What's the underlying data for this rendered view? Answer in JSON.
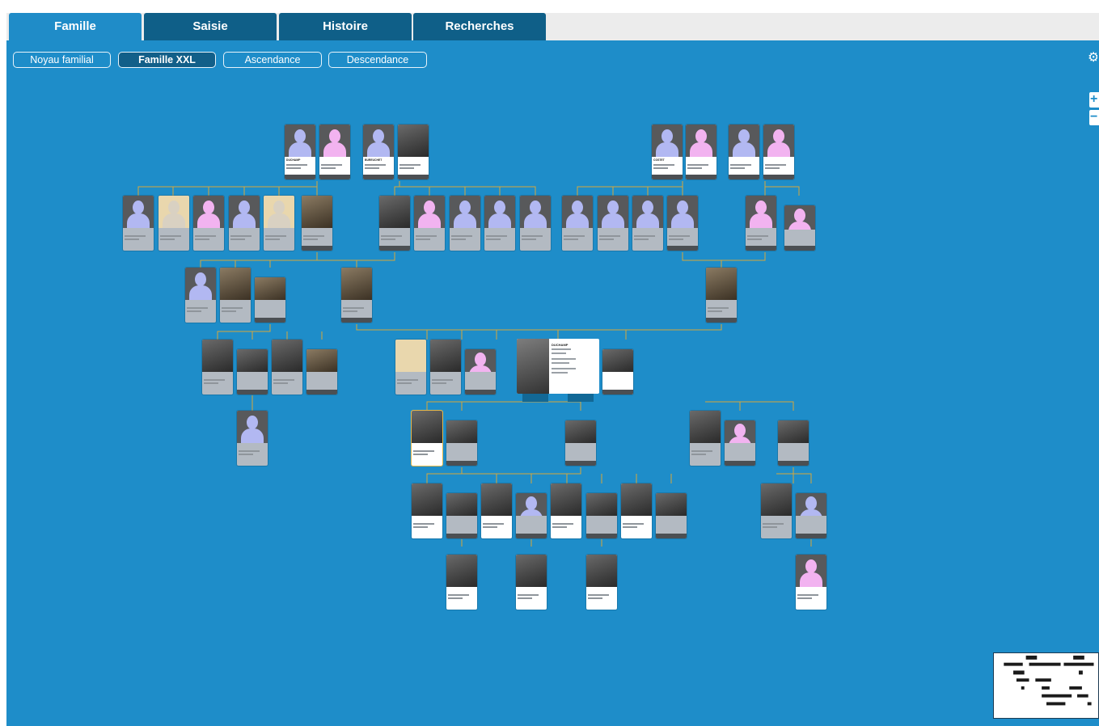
{
  "tabs": [
    {
      "label": "Famille",
      "active": true
    },
    {
      "label": "Saisie",
      "active": false
    },
    {
      "label": "Histoire",
      "active": false
    },
    {
      "label": "Recherches",
      "active": false
    }
  ],
  "subnav": [
    {
      "label": "Noyau familial",
      "active": false
    },
    {
      "label": "Famille XXL",
      "active": true
    },
    {
      "label": "Ascendance",
      "active": false
    },
    {
      "label": "Descendance",
      "active": false
    }
  ],
  "icons": {
    "settings": "gear-icon",
    "zoom_in": "plus-icon",
    "zoom_out": "minus-icon"
  },
  "colors": {
    "accent": "#1e8dc9",
    "tab": "#0f5f88",
    "active_tab": "#1f8cc8",
    "subnav_active": "#125f89"
  },
  "people": {
    "duchamp": "DUCHAMP",
    "bureuchet": "BUREUCHET",
    "costet": "COSTET"
  }
}
